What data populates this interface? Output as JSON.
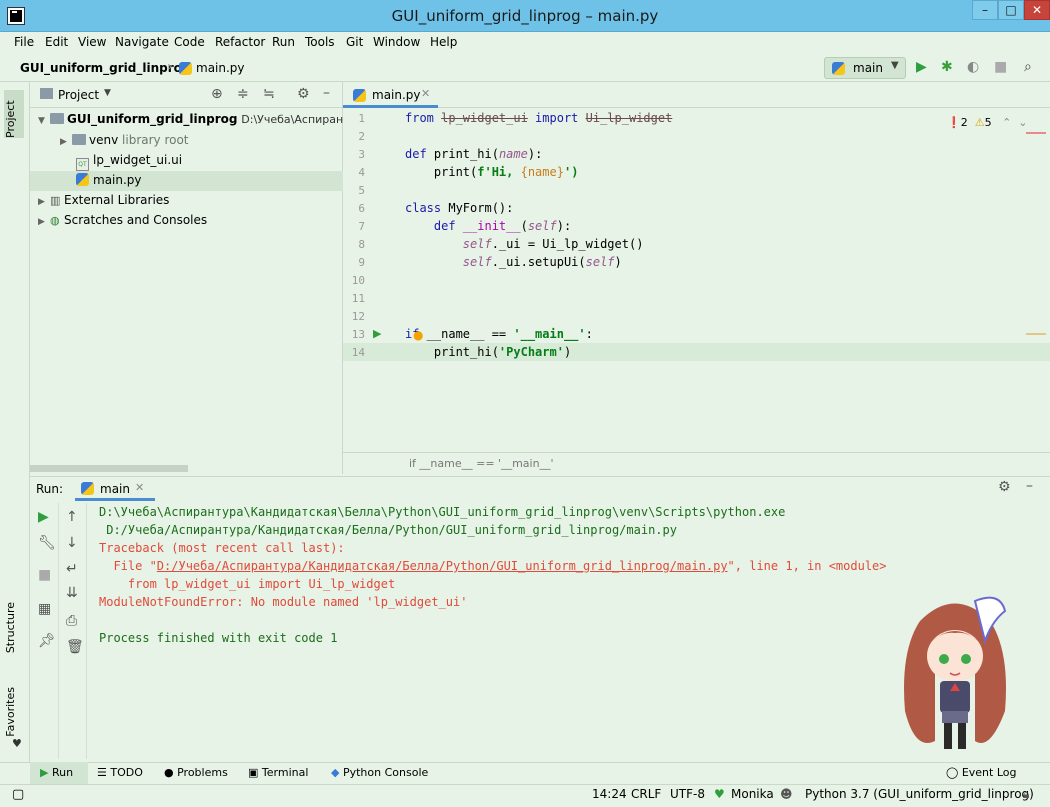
{
  "window": {
    "title": "GUI_uniform_grid_linprog – main.py"
  },
  "menu": [
    "File",
    "Edit",
    "View",
    "Navigate",
    "Code",
    "Refactor",
    "Run",
    "Tools",
    "Git",
    "Window",
    "Help"
  ],
  "navbar": {
    "project": "GUI_uniform_grid_linprog",
    "file": "main.py",
    "run_config": "main"
  },
  "project_panel": {
    "title": "Project",
    "root": {
      "name": "GUI_uniform_grid_linprog",
      "path": "D:\\Учеба\\Аспирантур"
    },
    "items": [
      {
        "name": "venv",
        "note": "library root"
      },
      {
        "name": "lp_widget_ui.ui"
      },
      {
        "name": "main.py"
      },
      {
        "name": "External Libraries"
      },
      {
        "name": "Scratches and Consoles"
      }
    ]
  },
  "left_strip": {
    "project": "Project",
    "structure": "Structure",
    "favorites": "Favorites"
  },
  "editor": {
    "tab": "main.py",
    "errors": "2",
    "warnings": "5",
    "line_numbers": [
      "1",
      "2",
      "3",
      "4",
      "5",
      "6",
      "7",
      "8",
      "9",
      "10",
      "11",
      "12",
      "13",
      "14"
    ],
    "lines": {
      "l1a": "from ",
      "l1b": "lp_widget_ui",
      "l1c": " import ",
      "l1d": "Ui_lp_widget",
      "l3a": "def ",
      "l3b": "print_hi(",
      "l3c": "name",
      "l3d": "):",
      "l4a": "    print(",
      "l4b": "f'Hi, ",
      "l4c": "{name}",
      "l4d": "')",
      "l6a": "class ",
      "l6b": "MyForm():",
      "l7a": "    def ",
      "l7b": "__init__",
      "l7c": "(",
      "l7d": "self",
      "l7e": "):",
      "l8a": "        ",
      "l8b": "self",
      "l8c": "._ui = Ui_lp_widget()",
      "l9a": "        ",
      "l9b": "self",
      "l9c": "._ui.setupUi(",
      "l9d": "self",
      "l9e": ")",
      "l13a": "if",
      "l13b": " __name__ == ",
      "l13c": "'__main__'",
      "l13d": ":",
      "l14a": "    print_hi(",
      "l14b": "'PyCharm'",
      "l14c": ")"
    },
    "breadcrumb": "if __name__ == '__main__'"
  },
  "run_panel": {
    "label": "Run:",
    "tab": "main",
    "console": {
      "c1": "D:\\Учеба\\Аспирантура\\Кандидатская\\Белла\\Python\\GUI_uniform_grid_linprog\\venv\\Scripts\\python.exe",
      "c2": " D:/Учеба/Аспирантура/Кандидатская/Белла/Python/GUI_uniform_grid_linprog/main.py",
      "c3": "Traceback (most recent call last):",
      "c4a": "  File \"",
      "c4b": "D:/Учеба/Аспирантура/Кандидатская/Белла/Python/GUI_uniform_grid_linprog/main.py",
      "c4c": "\", line 1, in <module>",
      "c5": "    from lp_widget_ui import Ui_lp_widget",
      "c6": "ModuleNotFoundError: No module named 'lp_widget_ui'",
      "c7": "Process finished with exit code 1"
    }
  },
  "bottom_tabs": {
    "run": "Run",
    "todo": "TODO",
    "problems": "Problems",
    "terminal": "Terminal",
    "python_console": "Python Console",
    "event_log": "Event Log"
  },
  "status": {
    "pos": "14:24",
    "eol": "CRLF",
    "enc": "UTF-8",
    "theme": "Monika",
    "interp": "Python 3.7 (GUI_uniform_grid_linprog)"
  },
  "colors": {
    "background": "#e7f3e7",
    "titlebar": "#6ec2e8",
    "accent": "#4a8cd0",
    "error": "#e04b3a"
  }
}
